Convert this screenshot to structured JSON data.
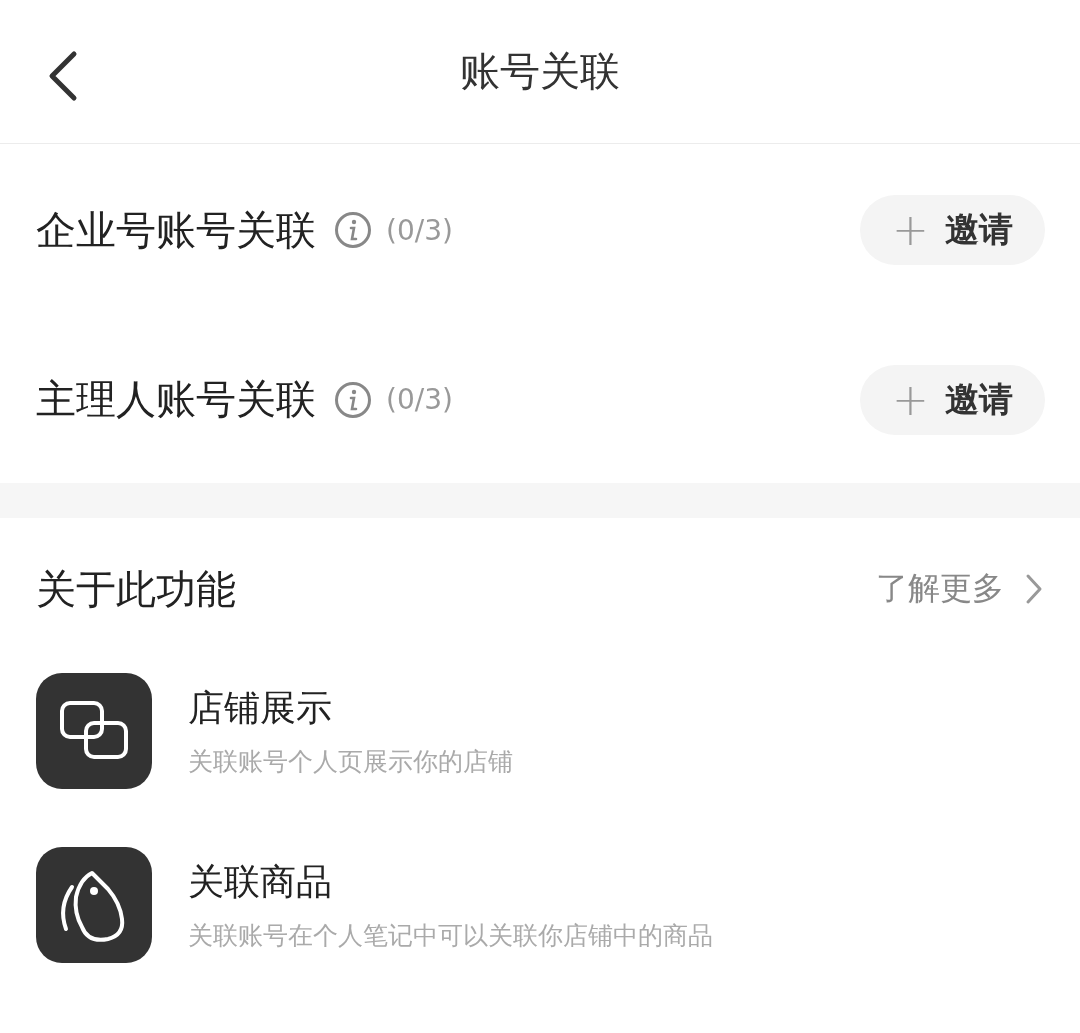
{
  "header": {
    "title": "账号关联"
  },
  "links": [
    {
      "label": "企业号账号关联",
      "count": "(0/3)",
      "button": {
        "icon": "+",
        "label": "邀请"
      }
    },
    {
      "label": "主理人账号关联",
      "count": "(0/3)",
      "button": {
        "icon": "+",
        "label": "邀请"
      }
    }
  ],
  "about": {
    "title": "关于此功能",
    "more": "了解更多",
    "features": [
      {
        "kind": "squares",
        "title": "店铺展示",
        "description": "关联账号个人页展示你的店铺"
      },
      {
        "kind": "tags",
        "title": "关联商品",
        "description": "关联账号在个人笔记中可以关联你店铺中的商品"
      }
    ]
  }
}
